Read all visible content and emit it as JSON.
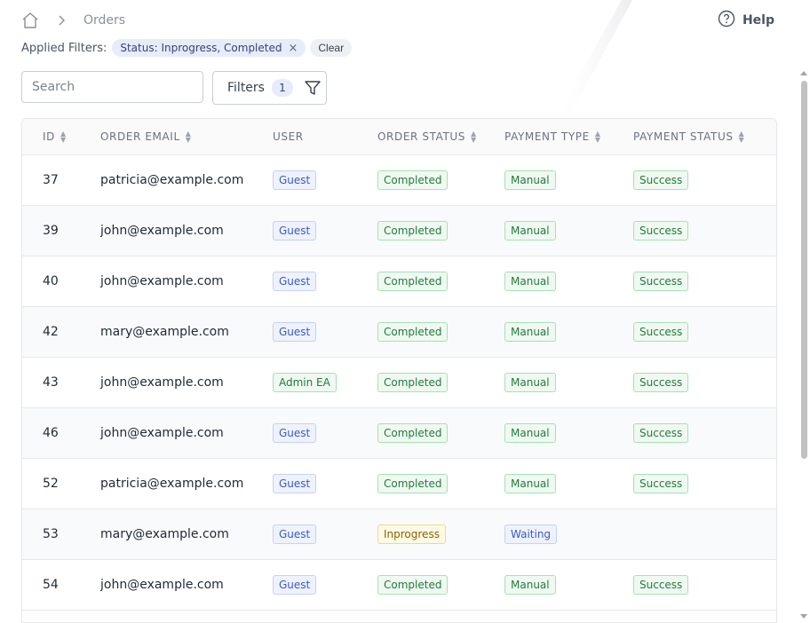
{
  "breadcrumb": {
    "home_icon": "home-icon",
    "separator_icon": "chevron-right-icon",
    "current": "Orders"
  },
  "help": {
    "icon": "question-circle-icon",
    "label": "Help"
  },
  "filters": {
    "applied_label": "Applied Filters:",
    "chip_label": "Status: Inprogress, Completed",
    "chip_remove": "×",
    "clear_label": "Clear"
  },
  "search": {
    "placeholder": "Search",
    "value": ""
  },
  "filters_button": {
    "label": "Filters",
    "count": "1",
    "icon": "funnel-icon"
  },
  "table": {
    "columns": [
      "ID",
      "ORDER EMAIL",
      "USER",
      "ORDER STATUS",
      "PAYMENT TYPE",
      "PAYMENT STATUS"
    ],
    "rows": [
      {
        "id": "37",
        "email": "patricia@example.com",
        "user": "Guest",
        "order_status": "Completed",
        "payment_type": "Manual",
        "payment_status": "Success"
      },
      {
        "id": "39",
        "email": "john@example.com",
        "user": "Guest",
        "order_status": "Completed",
        "payment_type": "Manual",
        "payment_status": "Success"
      },
      {
        "id": "40",
        "email": "john@example.com",
        "user": "Guest",
        "order_status": "Completed",
        "payment_type": "Manual",
        "payment_status": "Success"
      },
      {
        "id": "42",
        "email": "mary@example.com",
        "user": "Guest",
        "order_status": "Completed",
        "payment_type": "Manual",
        "payment_status": "Success"
      },
      {
        "id": "43",
        "email": "john@example.com",
        "user": "Admin EA",
        "order_status": "Completed",
        "payment_type": "Manual",
        "payment_status": "Success"
      },
      {
        "id": "46",
        "email": "john@example.com",
        "user": "Guest",
        "order_status": "Completed",
        "payment_type": "Manual",
        "payment_status": "Success"
      },
      {
        "id": "52",
        "email": "patricia@example.com",
        "user": "Guest",
        "order_status": "Completed",
        "payment_type": "Manual",
        "payment_status": "Success"
      },
      {
        "id": "53",
        "email": "mary@example.com",
        "user": "Guest",
        "order_status": "Inprogress",
        "payment_type": "Waiting",
        "payment_status": ""
      },
      {
        "id": "54",
        "email": "john@example.com",
        "user": "Guest",
        "order_status": "Completed",
        "payment_type": "Manual",
        "payment_status": "Success"
      }
    ]
  },
  "colors": {
    "badge_blue": "#3b5bbb",
    "badge_green": "#237a3e",
    "badge_yellow": "#8a6400",
    "chip_bg": "#e7ecfa"
  }
}
